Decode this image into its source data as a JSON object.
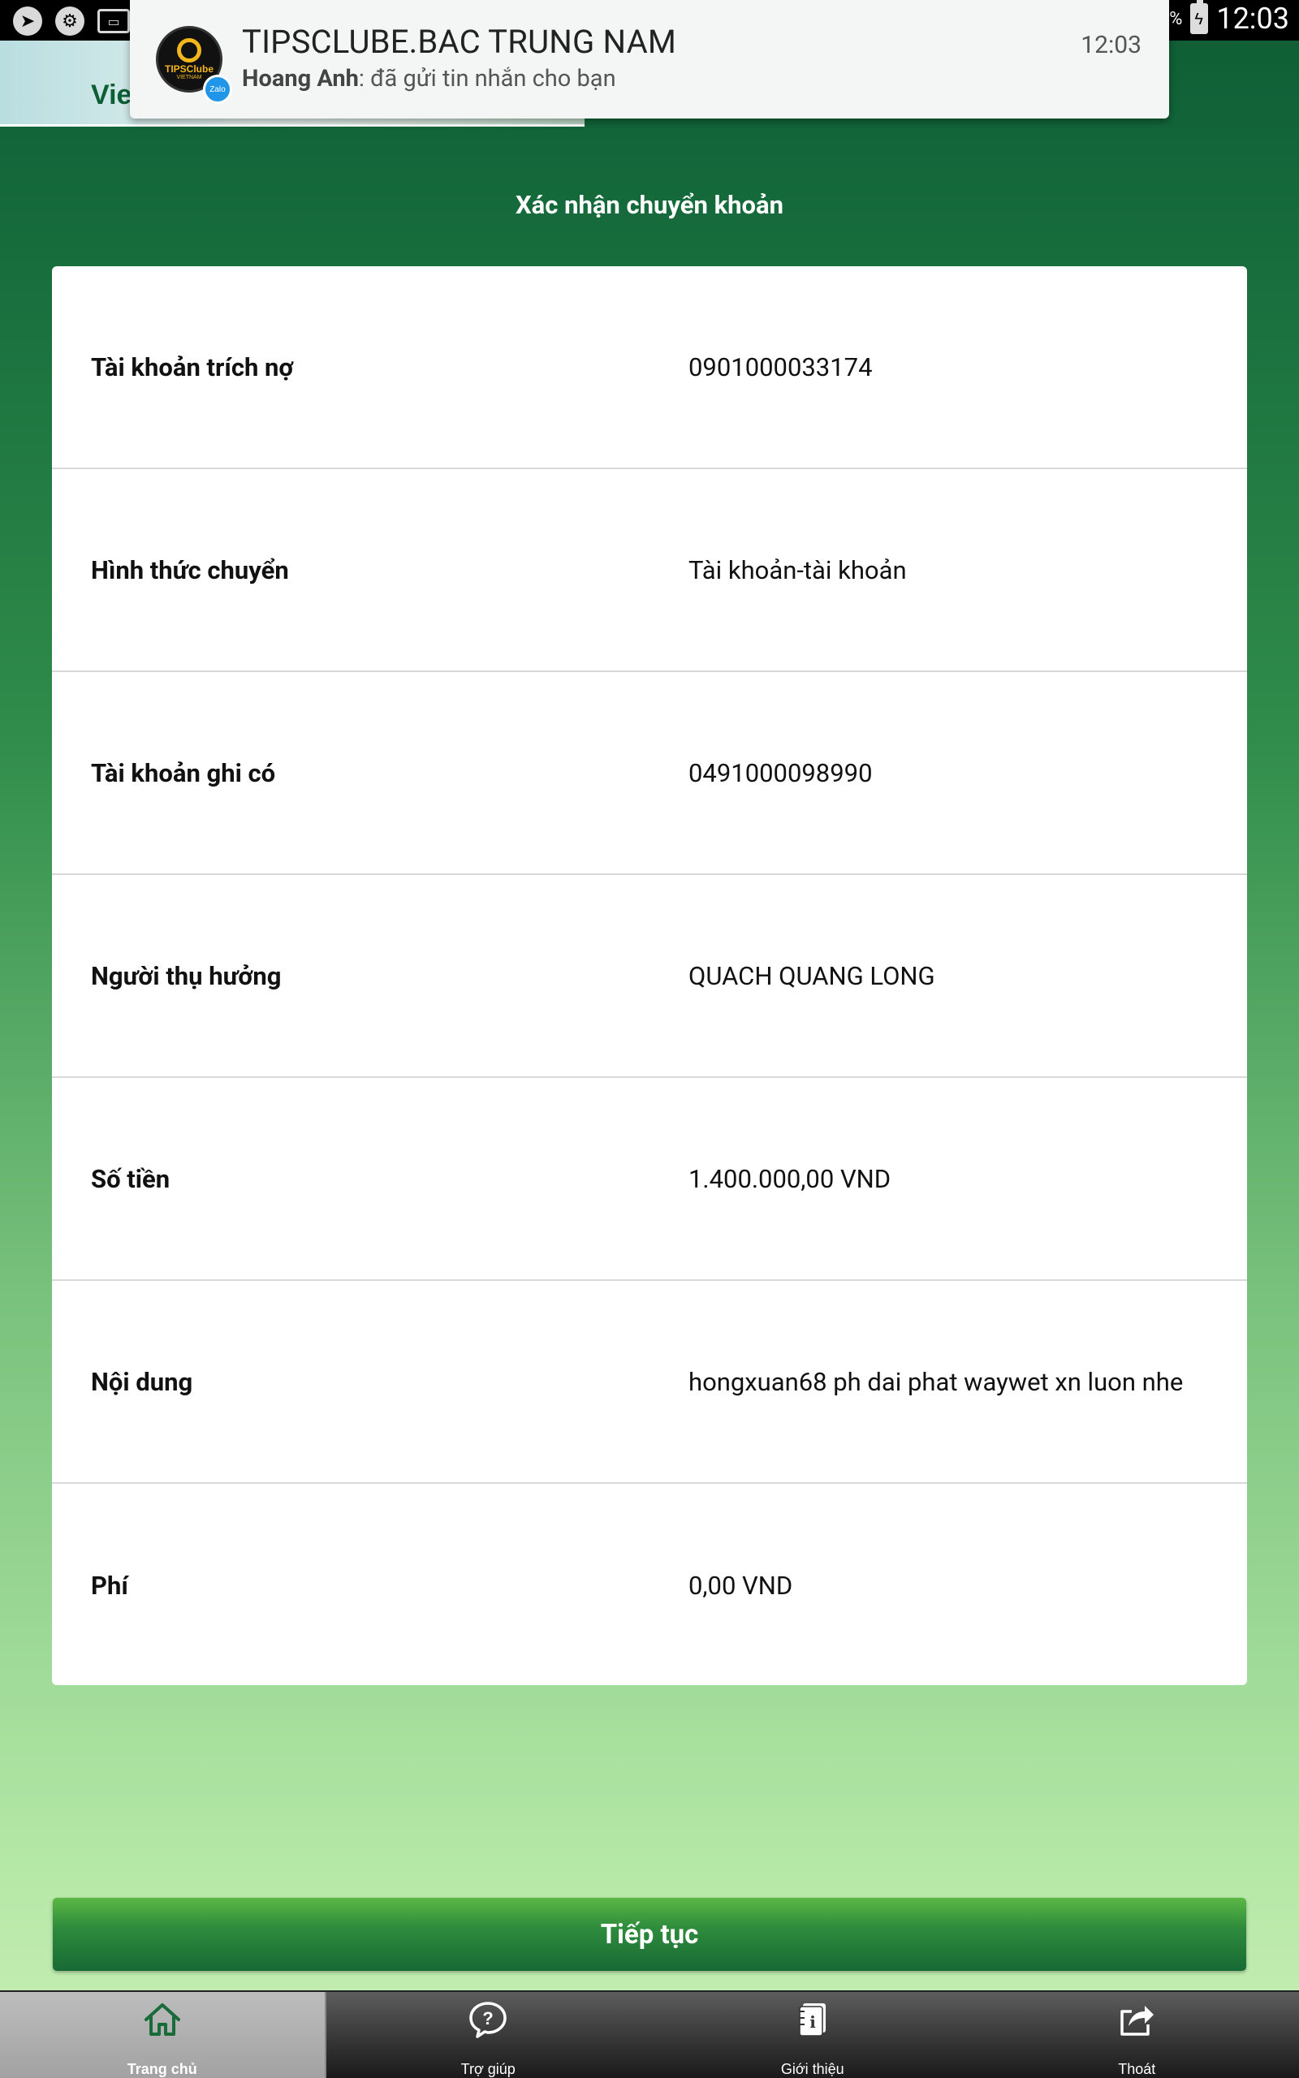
{
  "status_bar": {
    "battery_percent": "%",
    "time": "12:03"
  },
  "app_header": {
    "logo_text": "Vie"
  },
  "notification": {
    "avatar_brand": "TIPSClube",
    "avatar_sub": "VIETNAM",
    "badge_label": "Zalo",
    "title": "TIPSCLUBE.BAC TRUNG NAM",
    "time": "12:03",
    "sender": "Hoang Anh",
    "message": ": đã gửi tin nhắn cho bạn"
  },
  "page": {
    "title": "Xác nhận chuyển khoản"
  },
  "details": [
    {
      "label": "Tài khoản trích nợ",
      "value": "0901000033174"
    },
    {
      "label": "Hình thức chuyển",
      "value": "Tài khoản-tài khoản"
    },
    {
      "label": "Tài khoản ghi có",
      "value": "0491000098990"
    },
    {
      "label": "Người thụ hưởng",
      "value": "QUACH QUANG LONG"
    },
    {
      "label": "Số tiền",
      "value": "1.400.000,00 VND"
    },
    {
      "label": "Nội dung",
      "value": "hongxuan68 ph dai phat waywet xn luon nhe"
    },
    {
      "label": "Phí",
      "value": "0,00 VND"
    }
  ],
  "continue_button": {
    "label": "Tiếp tục"
  },
  "bottom_nav": {
    "items": [
      {
        "label": "Trang chủ",
        "icon": "home-icon",
        "active": true
      },
      {
        "label": "Trợ giúp",
        "icon": "help-icon",
        "active": false
      },
      {
        "label": "Giới thiệu",
        "icon": "info-book-icon",
        "active": false
      },
      {
        "label": "Thoát",
        "icon": "share-exit-icon",
        "active": false
      }
    ]
  },
  "colors": {
    "brand_green_dark": "#0f5c34",
    "brand_green_light": "#c2ecb0",
    "button_green": "#2f8c3c",
    "notification_badge": "#2196e8"
  }
}
